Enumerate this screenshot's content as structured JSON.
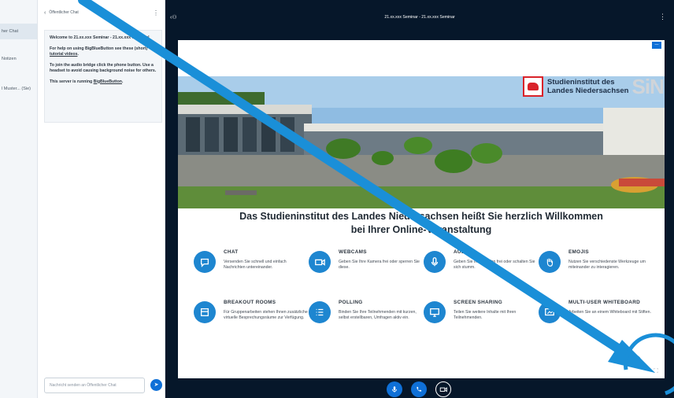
{
  "userlist": {
    "items": [
      "her Chat",
      "Notizen",
      "l Muster... (Sie)"
    ]
  },
  "chat": {
    "title": "Öffentlicher Chat",
    "welcome": {
      "heading": "Welcome to 21.xx.xxx Seminar - 21.xx.xxx Seminar!",
      "help_prefix": "For help on using BigBlueButton see these (short) ",
      "help_link": "tutorial videos",
      "help_suffix": ".",
      "audio_text": "To join the audio bridge click the phone button. Use a headset to avoid causing background noise for others.",
      "running_prefix": "This server is running ",
      "running_link": "BigBlueButton",
      "running_suffix": "."
    },
    "input_placeholder": "Nachricht senden an Öffentlicher Chat"
  },
  "header": {
    "meeting_title": "21.xx.xxx Seminar - 21.xx.xxx Seminar"
  },
  "slide": {
    "brand_line1": "Studieninstitut des",
    "brand_line2": "Landes Niedersachsen",
    "brand_mark": "SiN",
    "headline_line1": "Das Studieninstitut des Landes Niedersachsen heißt Sie herzlich Willkommen",
    "headline_line2": "bei Ihrer Online-Veranstaltung",
    "features": [
      {
        "title": "CHAT",
        "desc": "Versenden Sie schnell und einfach Nachrichten untereinander.",
        "icon": "chat-icon"
      },
      {
        "title": "WEBCAMS",
        "desc": "Geben Sie Ihre Kamera frei oder sperren Sie diese.",
        "icon": "camera-icon"
      },
      {
        "title": "AUDIO",
        "desc": "Geben Sie Ihr Mikrofon frei oder schalten Sie sich stumm.",
        "icon": "microphone-icon"
      },
      {
        "title": "EMOJIS",
        "desc": "Nutzen Sie verschiedenste Werkzeuge um miteinander zu interagieren.",
        "icon": "hand-icon"
      },
      {
        "title": "BREAKOUT ROOMS",
        "desc": "Für Gruppenarbeiten stehen Ihnen zusätzliche virtuelle Besprechungsräume zur Verfügung.",
        "icon": "rooms-icon"
      },
      {
        "title": "POLLING",
        "desc": "Binden Sie Ihre Teilnehmenden mit kurzen, selbst erstellbaren, Umfragen aktiv ein.",
        "icon": "list-icon"
      },
      {
        "title": "SCREEN SHARING",
        "desc": "Teilen Sie weitere Inhalte mit Ihren Teilnehmenden.",
        "icon": "monitor-icon"
      },
      {
        "title": "MULTI-USER WHITEBOARD",
        "desc": "Arbeiten Sie an einem Whiteboard mit Stiften.",
        "icon": "whiteboard-icon"
      }
    ]
  },
  "controls": [
    "microphone-icon",
    "phone-icon",
    "camera-icon"
  ],
  "colors": {
    "accent": "#0f70d7",
    "dark_bg": "#06172a",
    "feature_icon": "#1e86d0",
    "annotation": "#1a8fd8"
  }
}
